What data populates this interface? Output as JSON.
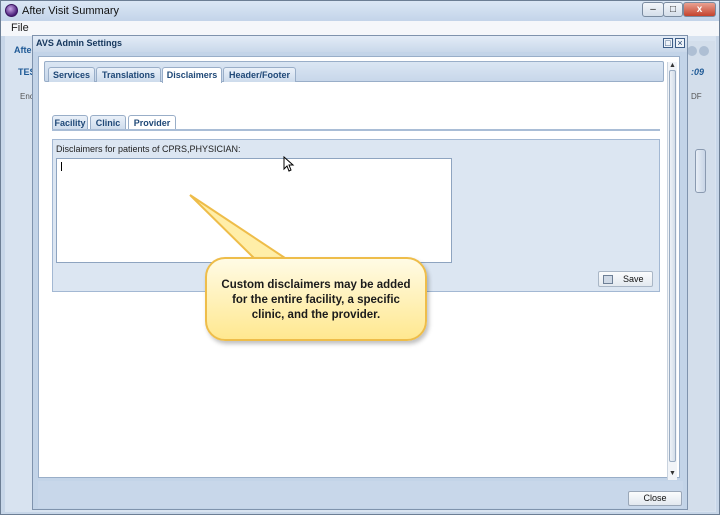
{
  "window": {
    "title": "After Visit Summary",
    "menu_file": "File",
    "btn_min": "–",
    "btn_max": "□",
    "btn_close": "x"
  },
  "background": {
    "label_afte": "Afte",
    "label_tes": "TES",
    "label_enc": "Enc",
    "label_time": ":09",
    "label_df": "DF"
  },
  "dialog": {
    "title": "AVS Admin Settings",
    "restore_glyph": "□",
    "close_glyph": "×",
    "tabs": [
      {
        "label": "Services"
      },
      {
        "label": "Translations"
      },
      {
        "label": "Disclaimers"
      },
      {
        "label": "Header/Footer"
      }
    ],
    "active_tab": "Disclaimers",
    "subtabs": [
      {
        "label": "Facility"
      },
      {
        "label": "Clinic"
      },
      {
        "label": "Provider"
      }
    ],
    "active_subtab": "Provider",
    "panel_label": "Disclaimers for patients of CPRS,PHYSICIAN:",
    "textarea_value": "",
    "save_label": "Save",
    "close_label": "Close",
    "scroll_up": "▲",
    "scroll_down": "▼"
  },
  "callout": {
    "text": "Custom disclaimers may be added for the entire facility, a specific clinic, and the provider."
  },
  "colors": {
    "tab_text": "#1f4877",
    "callout_fill": "#ffe890",
    "callout_border": "#eebd4a"
  }
}
